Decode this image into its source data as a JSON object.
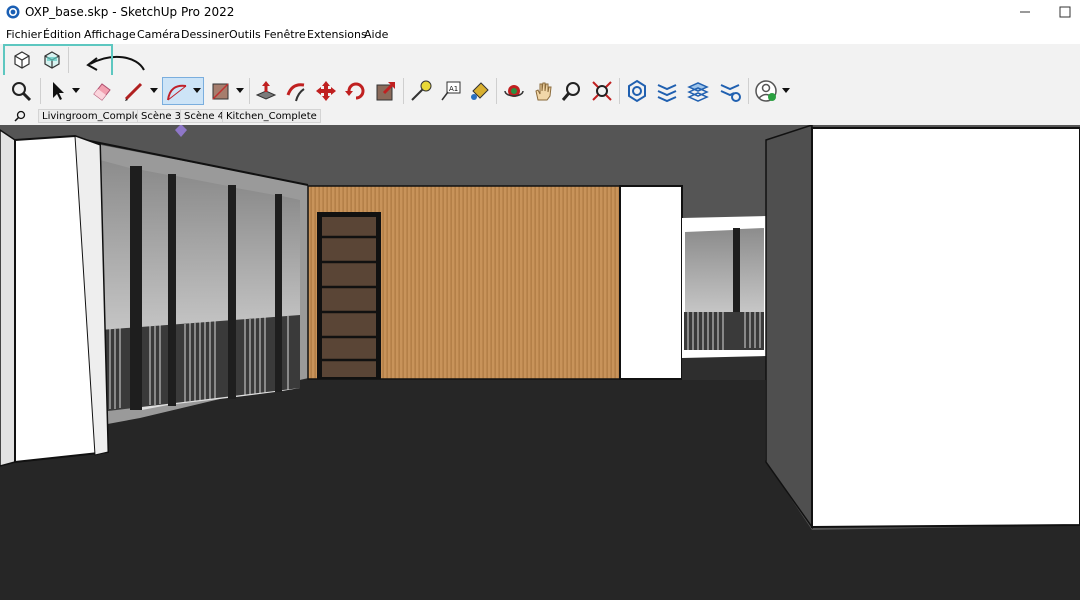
{
  "window": {
    "title": "OXP_base.skp - SketchUp Pro 2022"
  },
  "menu": {
    "items": [
      "Fichier",
      "Édition",
      "Affichage",
      "Caméra",
      "Dessiner",
      "Outils",
      "Fenêtre",
      "Extensions",
      "Aide"
    ]
  },
  "oxp_toolbar": {
    "icons": [
      "oxp-export-cube-icon",
      "oxp-cube-icon"
    ]
  },
  "main_toolbar": {
    "icons": [
      "zoom-extents-icon",
      "select-arrow-icon",
      "eraser-icon",
      "pencil-line-icon",
      "arc-icon",
      "rectangle-icon",
      "push-pull-icon",
      "follow-me-icon",
      "move-icon",
      "rotate-icon",
      "scale-icon",
      "tape-measure-icon",
      "text-icon",
      "paint-bucket-icon",
      "orbit-icon",
      "pan-hand-icon",
      "zoom-icon",
      "zoom-extents-red-icon",
      "warehouse-icon",
      "extension-warehouse-icon",
      "layout-icon",
      "extension-manager-icon",
      "profile-icon"
    ]
  },
  "scenes": {
    "tabs": [
      "Livingroom_Complete",
      "Scène 3",
      "Scène 4",
      "Kitchen_Complete"
    ]
  },
  "colors": {
    "highlight": "#5dc7c0",
    "toolbar_bg": "#f2f2f2",
    "floor": "#262626",
    "ceiling": "#555555",
    "wood_wall": "#c8935a"
  }
}
